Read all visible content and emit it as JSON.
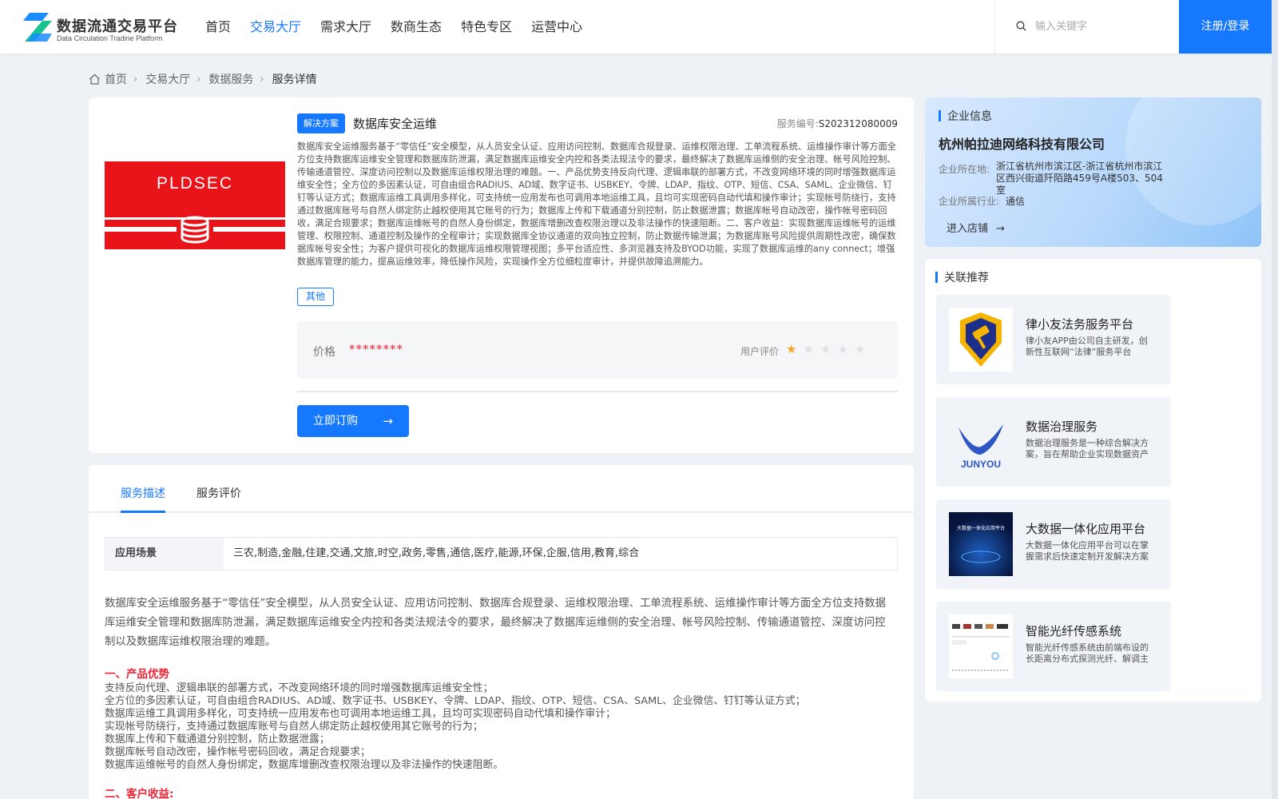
{
  "header": {
    "logo_title": "数据流通交易平台",
    "logo_subtitle": "Data Circulation Tradine Platform",
    "nav": [
      {
        "label": "首页"
      },
      {
        "label": "交易大厅"
      },
      {
        "label": "需求大厅"
      },
      {
        "label": "数商生态"
      },
      {
        "label": "特色专区"
      },
      {
        "label": "运营中心"
      }
    ],
    "active_nav": "交易大厅",
    "search_placeholder": "输入关键字",
    "login_label": "注册/登录"
  },
  "breadcrumb": [
    "首页",
    "交易大厅",
    "数据服务",
    "服务详情"
  ],
  "product": {
    "badge": "解决方案",
    "title": "数据库安全运维",
    "code_label": "服务编号:",
    "code": "S202312080009",
    "image_text": "PLDSEC",
    "description": "数据库安全运维服务基于“零信任”安全模型，从人员安全认证、应用访问控制、数据库合规登录、运维权限治理、工单流程系统、运维操作审计等方面全方位支持数据库运维安全管理和数据库防泄漏，满足数据库运维安全内控和各类法规法令的要求，最终解决了数据库运维侧的安全治理、帐号风险控制、传输通道管控、深度访问控制以及数据库运维权限治理的难题。一、产品优势支持反向代理、逻辑串联的部署方式，不改变网络环境的同时增强数据库运维安全性；全方位的多因素认证，可自由组合RADIUS、AD域、数字证书、USBKEY、令牌、LDAP、指纹、OTP、短信、CSA、SAML、企业微信、钉钉等认证方式；数据库运维工具调用多样化，可支持统一应用发布也可调用本地运维工具，且均可实现密码自动代填和操作审计；实现帐号防绕行，支持通过数据库账号与自然人绑定防止越权使用其它账号的行为；数据库上传和下载通道分别控制，防止数据泄露；数据库帐号自动改密，操作帐号密码回收，满足合规要求；数据库运维帐号的自然人身份绑定，数据库增删改查权限治理以及非法操作的快速阻断。二、客户收益：实现数据库运维帐号的运维管理、权限控制、通道控制及操作的全程审计；实现数据库全协议通道的双向独立控制，防止数据传输泄漏；为数据库账号风险提供周期性改密，确保数据库帐号安全性；为客户提供可视化的数据库运维权限管理视图；多平台适应性、多浏览器支持及BYOD功能，实现了数据库运维的any connect；增强数据库管理的能力，提高运维效率，降低操作风险，实现操作全方位细粒度审计，并提供故障追溯能力。",
    "tag": "其他",
    "price_label": "价格",
    "price_value": "********",
    "rating_label": "用户评价",
    "rating": 1,
    "rating_max": 5,
    "order_label": "立即订购"
  },
  "tabs": [
    {
      "label": "服务描述"
    },
    {
      "label": "服务评价"
    }
  ],
  "detail": {
    "scene_label": "应用场景",
    "scene_value": "三农,制造,金融,住建,交通,文旅,时空,政务,零售,通信,医疗,能源,环保,企服,信用,教育,综合",
    "intro": "数据库安全运维服务基于“零信任”安全模型，从人员安全认证、应用访问控制、数据库合规登录、运维权限治理、工单流程系统、运维操作审计等方面全方位支持数据库运维安全管理和数据库防泄漏，满足数据库运维安全内控和各类法规法令的要求，最终解决了数据库运维侧的安全治理、帐号风险控制、传输通道管控、深度访问控制以及数据库运维权限治理的难题。",
    "section1_title": "一、产品优势",
    "advantages": [
      "支持反向代理、逻辑串联的部署方式，不改变网络环境的同时增强数据库运维安全性；",
      "全方位的多因素认证，可自由组合RADIUS、AD域、数字证书、USBKEY、令牌、LDAP、指纹、OTP、短信、CSA、SAML、企业微信、钉钉等认证方式；",
      "数据库运维工具调用多样化，可支持统一应用发布也可调用本地运维工具，且均可实现密码自动代填和操作审计；",
      "实现帐号防绕行，支持通过数据库账号与自然人绑定防止越权使用其它账号的行为；",
      "数据库上传和下载通道分别控制，防止数据泄露；",
      "数据库帐号自动改密，操作帐号密码回收，满足合规要求；",
      "数据库运维帐号的自然人身份绑定，数据库增删改查权限治理以及非法操作的快速阻断。"
    ],
    "section2_title": "二、客户收益:"
  },
  "enterprise": {
    "section_title": "企业信息",
    "name": "杭州帕拉迪网络科技有限公司",
    "location_label": "企业所在地:",
    "location": "浙江省杭州市滨江区-浙江省杭州市滨江区西兴街道阡陌路459号A楼503、504室",
    "industry_label": "企业所属行业:",
    "industry": "通信",
    "enter_label": "进入店铺"
  },
  "recommend": {
    "section_title": "关联推荐",
    "items": [
      {
        "name": "律小友法务服务平台",
        "desc": "律小友APP由公司自主研发，创新性互联网“法律”服务平台"
      },
      {
        "name": "数据治理服务",
        "desc": "数据治理服务是一种综合解决方案，旨在帮助企业实现数据资产的有效管理",
        "logo_text": "JUNYOU"
      },
      {
        "name": "大数据一体化应用平台",
        "desc": "大数据一体化应用平台可以在掌握需求后快速定制开发解决方案",
        "thumb_text": "大数据一体化应用平台"
      },
      {
        "name": "智能光纤传感系统",
        "desc": "智能光纤传感系统由前端布设的长距离分布式探测光纤、解调主机组成"
      }
    ]
  },
  "colors": {
    "primary": "#1677ff",
    "accent_red": "#e23",
    "page_bg": "#eef2f7",
    "star": "#f5a623",
    "brand_red": "#e8141a"
  }
}
